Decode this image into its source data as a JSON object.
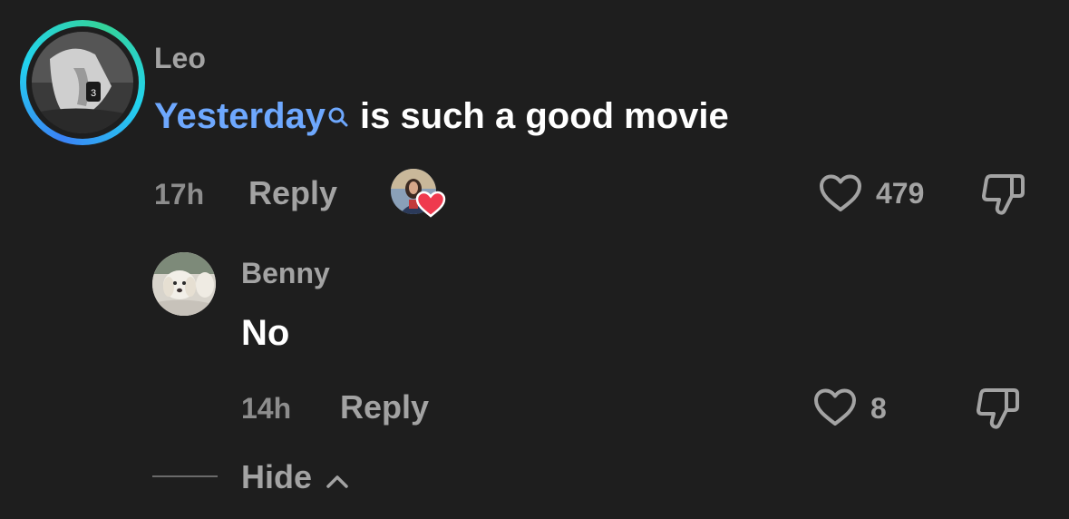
{
  "comment": {
    "username": "Leo",
    "link_text": "Yesterday",
    "text": "is such a good movie",
    "time": "17h",
    "reply_label": "Reply",
    "like_count": "479"
  },
  "reply": {
    "username": "Benny",
    "text": "No",
    "time": "14h",
    "reply_label": "Reply",
    "like_count": "8"
  },
  "thread": {
    "hide_label": "Hide"
  },
  "colors": {
    "background": "#1e1e1e",
    "link": "#6ea8fe",
    "muted": "#a3a3a3",
    "heart_badge": "#ef3a4e"
  }
}
